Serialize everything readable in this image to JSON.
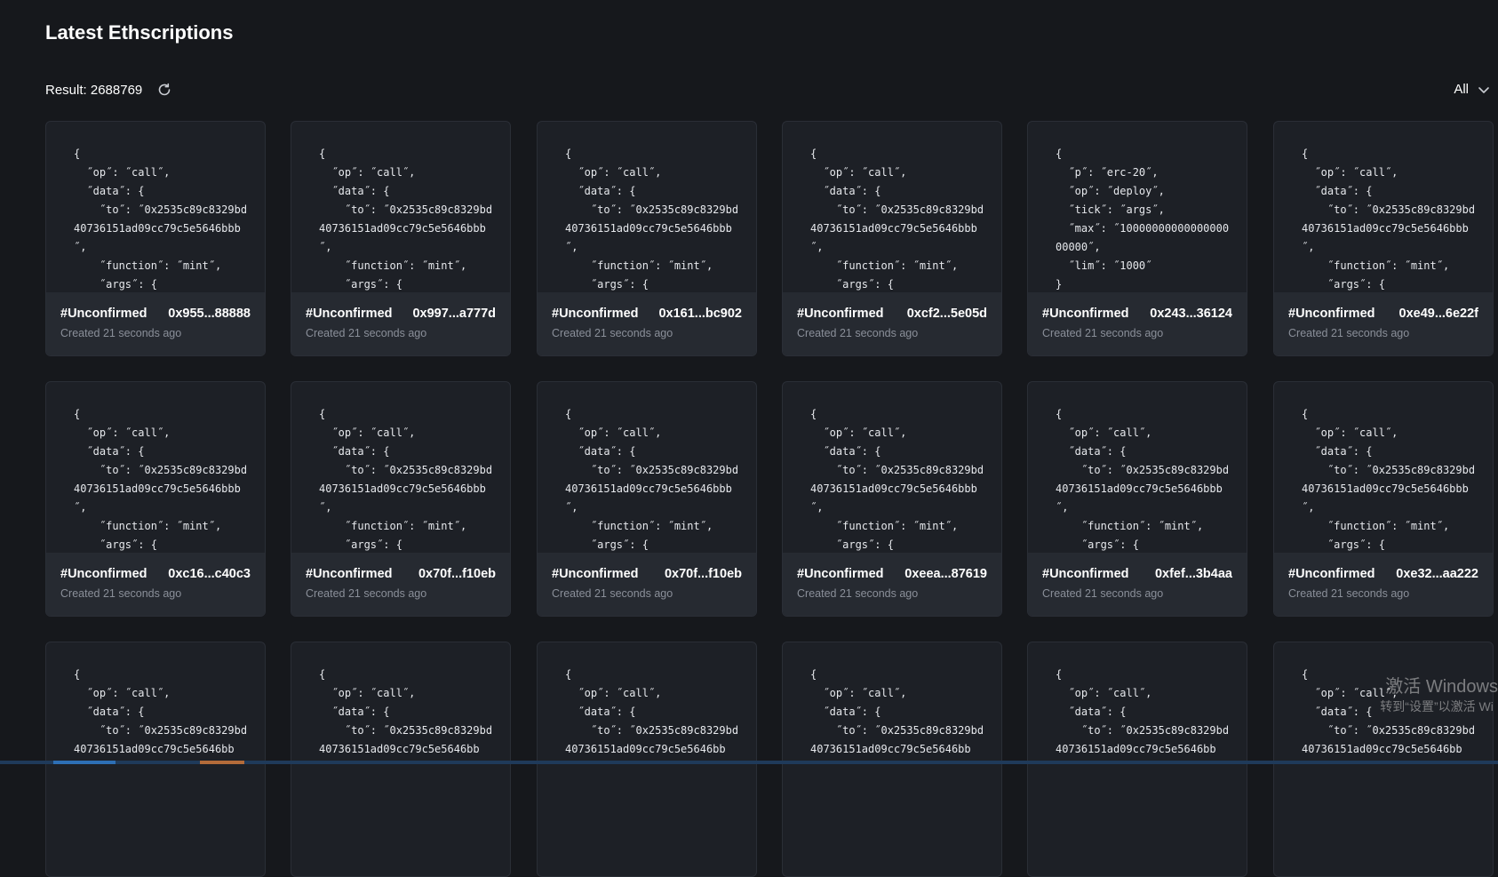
{
  "page": {
    "title": "Latest Ethscriptions",
    "result_label": "Result: 2688769",
    "filter_label": "All"
  },
  "icons": {
    "refresh": "refresh-icon",
    "filter": "chevron-down-icon"
  },
  "cards": [
    {
      "content": "{\n  ˝op˝: ˝call˝,\n  ˝data˝: {\n    ˝to˝: ˝0x2535c89c8329bd40736151ad09cc79c5e5646bbb˝,\n    ˝function˝: ˝mint˝,\n    ˝args˝: {",
      "number": "#Unconfirmed",
      "hash": "0x955...88888",
      "created": "Created 21 seconds ago"
    },
    {
      "content": "{\n  ˝op˝: ˝call˝,\n  ˝data˝: {\n    ˝to˝: ˝0x2535c89c8329bd40736151ad09cc79c5e5646bbb˝,\n    ˝function˝: ˝mint˝,\n    ˝args˝: {",
      "number": "#Unconfirmed",
      "hash": "0x997...a777d",
      "created": "Created 21 seconds ago"
    },
    {
      "content": "{\n  ˝op˝: ˝call˝,\n  ˝data˝: {\n    ˝to˝: ˝0x2535c89c8329bd40736151ad09cc79c5e5646bbb˝,\n    ˝function˝: ˝mint˝,\n    ˝args˝: {",
      "number": "#Unconfirmed",
      "hash": "0x161...bc902",
      "created": "Created 21 seconds ago"
    },
    {
      "content": "{\n  ˝op˝: ˝call˝,\n  ˝data˝: {\n    ˝to˝: ˝0x2535c89c8329bd40736151ad09cc79c5e5646bbb˝,\n    ˝function˝: ˝mint˝,\n    ˝args˝: {",
      "number": "#Unconfirmed",
      "hash": "0xcf2...5e05d",
      "created": "Created 21 seconds ago"
    },
    {
      "content": "{\n  ˝p˝: ˝erc-20˝,\n  ˝op˝: ˝deploy˝,\n  ˝tick˝: ˝args˝,\n  ˝max˝: ˝1000000000000000000000˝,\n  ˝lim˝: ˝1000˝\n}",
      "number": "#Unconfirmed",
      "hash": "0x243...36124",
      "created": "Created 21 seconds ago"
    },
    {
      "content": "{\n  ˝op˝: ˝call˝,\n  ˝data˝: {\n    ˝to˝: ˝0x2535c89c8329bd40736151ad09cc79c5e5646bbb˝,\n    ˝function˝: ˝mint˝,\n    ˝args˝: {",
      "number": "#Unconfirmed",
      "hash": "0xe49...6e22f",
      "created": "Created 21 seconds ago"
    },
    {
      "content": "{\n  ˝op˝: ˝call˝,\n  ˝data˝: {\n    ˝to˝: ˝0x2535c89c8329bd40736151ad09cc79c5e5646bbb˝,\n    ˝function˝: ˝mint˝,\n    ˝args˝: {",
      "number": "#Unconfirmed",
      "hash": "0xc16...c40c3",
      "created": "Created 21 seconds ago"
    },
    {
      "content": "{\n  ˝op˝: ˝call˝,\n  ˝data˝: {\n    ˝to˝: ˝0x2535c89c8329bd40736151ad09cc79c5e5646bbb˝,\n    ˝function˝: ˝mint˝,\n    ˝args˝: {",
      "number": "#Unconfirmed",
      "hash": "0x70f...f10eb",
      "created": "Created 21 seconds ago"
    },
    {
      "content": "{\n  ˝op˝: ˝call˝,\n  ˝data˝: {\n    ˝to˝: ˝0x2535c89c8329bd40736151ad09cc79c5e5646bbb˝,\n    ˝function˝: ˝mint˝,\n    ˝args˝: {",
      "number": "#Unconfirmed",
      "hash": "0x70f...f10eb",
      "created": "Created 21 seconds ago"
    },
    {
      "content": "{\n  ˝op˝: ˝call˝,\n  ˝data˝: {\n    ˝to˝: ˝0x2535c89c8329bd40736151ad09cc79c5e5646bbb˝,\n    ˝function˝: ˝mint˝,\n    ˝args˝: {",
      "number": "#Unconfirmed",
      "hash": "0xeea...87619",
      "created": "Created 21 seconds ago"
    },
    {
      "content": "{\n  ˝op˝: ˝call˝,\n  ˝data˝: {\n    ˝to˝: ˝0x2535c89c8329bd40736151ad09cc79c5e5646bbb˝,\n    ˝function˝: ˝mint˝,\n    ˝args˝: {",
      "number": "#Unconfirmed",
      "hash": "0xfef...3b4aa",
      "created": "Created 21 seconds ago"
    },
    {
      "content": "{\n  ˝op˝: ˝call˝,\n  ˝data˝: {\n    ˝to˝: ˝0x2535c89c8329bd40736151ad09cc79c5e5646bbb˝,\n    ˝function˝: ˝mint˝,\n    ˝args˝: {",
      "number": "#Unconfirmed",
      "hash": "0xe32...aa222",
      "created": "Created 21 seconds ago"
    },
    {
      "content": "{\n  ˝op˝: ˝call˝,\n  ˝data˝: {\n    ˝to˝: ˝0x2535c89c8329bd40736151ad09cc79c5e5646bb",
      "number": "",
      "hash": "",
      "created": ""
    },
    {
      "content": "{\n  ˝op˝: ˝call˝,\n  ˝data˝: {\n    ˝to˝: ˝0x2535c89c8329bd40736151ad09cc79c5e5646bb",
      "number": "",
      "hash": "",
      "created": ""
    },
    {
      "content": "{\n  ˝op˝: ˝call˝,\n  ˝data˝: {\n    ˝to˝: ˝0x2535c89c8329bd40736151ad09cc79c5e5646bb",
      "number": "",
      "hash": "",
      "created": ""
    },
    {
      "content": "{\n  ˝op˝: ˝call˝,\n  ˝data˝: {\n    ˝to˝: ˝0x2535c89c8329bd40736151ad09cc79c5e5646bb",
      "number": "",
      "hash": "",
      "created": ""
    },
    {
      "content": "{\n  ˝op˝: ˝call˝,\n  ˝data˝: {\n    ˝to˝: ˝0x2535c89c8329bd40736151ad09cc79c5e5646bb",
      "number": "",
      "hash": "",
      "created": ""
    },
    {
      "content": "{\n  ˝op˝: ˝call˝,\n  ˝data˝: {\n    ˝to˝: ˝0x2535c89c8329bd40736151ad09cc79c5e5646bb",
      "number": "",
      "hash": "",
      "created": ""
    }
  ],
  "watermark": {
    "line1": "激活 Windows",
    "line2": "转到“设置”以激活 Wi"
  },
  "colors": {
    "background": "#16181c",
    "card": "#1d2026",
    "card_footer": "#262a31",
    "muted_text": "#8a8f99"
  }
}
